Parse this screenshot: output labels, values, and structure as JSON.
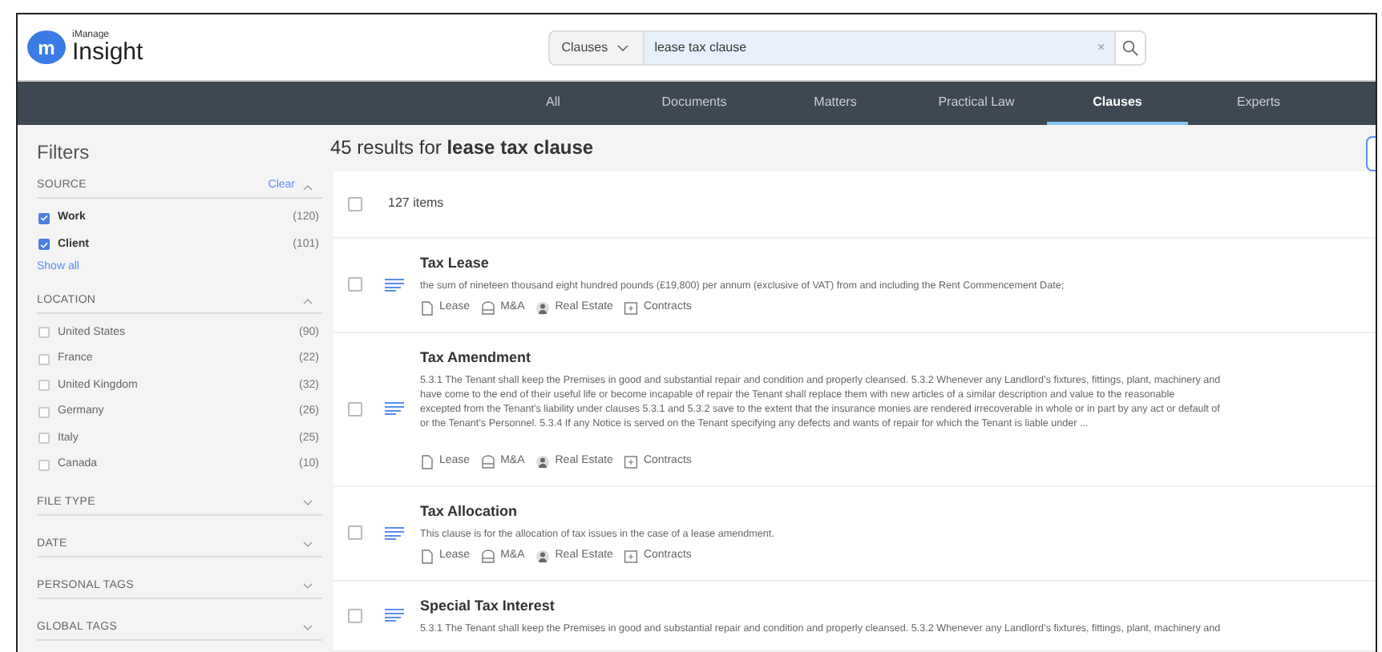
{
  "brand": {
    "mark": "m",
    "top": "iManage",
    "name": "Insight"
  },
  "search": {
    "scope": "Clauses",
    "value": "lease tax clause",
    "clear": "×"
  },
  "nav": [
    {
      "label": "All",
      "selected": false
    },
    {
      "label": "Documents",
      "selected": false
    },
    {
      "label": "Matters",
      "selected": false
    },
    {
      "label": "Practical Law",
      "selected": false
    },
    {
      "label": "Clauses",
      "selected": true
    },
    {
      "label": "Experts",
      "selected": false
    }
  ],
  "filters": {
    "title": "Filters",
    "sections": [
      {
        "title": "SOURCE",
        "expanded": true,
        "clear": "Clear",
        "show_all": "Show all",
        "options": [
          {
            "label": "Work",
            "count": "(120)",
            "checked": true
          },
          {
            "label": "Client",
            "count": "(101)",
            "checked": true
          }
        ]
      },
      {
        "title": "LOCATION",
        "expanded": true,
        "options": [
          {
            "label": "United States",
            "count": "(90)",
            "checked": false
          },
          {
            "label": "France",
            "count": "(22)",
            "checked": false
          },
          {
            "label": "United Kingdom",
            "count": "(32)",
            "checked": false
          },
          {
            "label": "Germany",
            "count": "(26)",
            "checked": false
          },
          {
            "label": "Italy",
            "count": "(25)",
            "checked": false
          },
          {
            "label": "Canada",
            "count": "(10)",
            "checked": false
          }
        ]
      },
      {
        "title": "FILE TYPE",
        "expanded": false
      },
      {
        "title": "DATE",
        "expanded": false
      },
      {
        "title": "PERSONAL TAGS",
        "expanded": false
      },
      {
        "title": "GLOBAL TAGS",
        "expanded": false
      }
    ]
  },
  "results": {
    "heading": "45 results for **lease tax clause**",
    "count": "127 items",
    "all_checked": false,
    "items": [
      {
        "title": "Tax Lease",
        "checked": false,
        "lines": [
          "the sum of nineteen thousand eight hundred pounds (£19,800) per annum (exclusive of VAT) from and including the Rent Commencement Date;"
        ],
        "tags": [
          {
            "kind": "document",
            "label": "Lease"
          },
          {
            "kind": "drawer",
            "label": "M&A"
          },
          {
            "kind": "person",
            "label": "Real Estate"
          },
          {
            "kind": "contract",
            "label": "Contracts"
          }
        ]
      },
      {
        "title": "Tax Amendment",
        "checked": false,
        "lines": [
          "5.3.1 The Tenant shall keep the Premises in good and substantial repair and condition and properly cleansed. 5.3.2 Whenever any Landlord’s fixtures, fittings, plant, machinery and",
          "have come to the end of their useful life or become incapable of repair the Tenant shall replace them with new articles of a similar description and value to the reasonable",
          "excepted from the Tenant’s liability under clauses 5.3.1 and 5.3.2 save to the extent that the insurance monies are rendered irrecoverable in whole or in part by any act or default of",
          "or the Tenant’s Personnel. 5.3.4 If any Notice is served on the Tenant specifying any defects and wants of repair for which the Tenant is liable under ..."
        ],
        "tags": [
          {
            "kind": "document",
            "label": "Lease"
          },
          {
            "kind": "drawer",
            "label": "M&A"
          },
          {
            "kind": "person",
            "label": "Real Estate"
          },
          {
            "kind": "contract",
            "label": "Contracts"
          }
        ]
      },
      {
        "title": "Tax Allocation",
        "checked": false,
        "lines": [
          "This clause is for the allocation of tax issues in the case of a lease amendment."
        ],
        "tags": [
          {
            "kind": "document",
            "label": "Lease"
          },
          {
            "kind": "drawer",
            "label": "M&A"
          },
          {
            "kind": "person",
            "label": "Real Estate"
          },
          {
            "kind": "contract",
            "label": "Contracts"
          }
        ]
      },
      {
        "title": "Special Tax Interest",
        "checked": false,
        "lines": [
          "5.3.1 The Tenant shall keep the Premises in good and substantial repair and condition and properly cleansed. 5.3.2 Whenever any Landlord’s fixtures, fittings, plant, machinery and"
        ]
      }
    ]
  }
}
